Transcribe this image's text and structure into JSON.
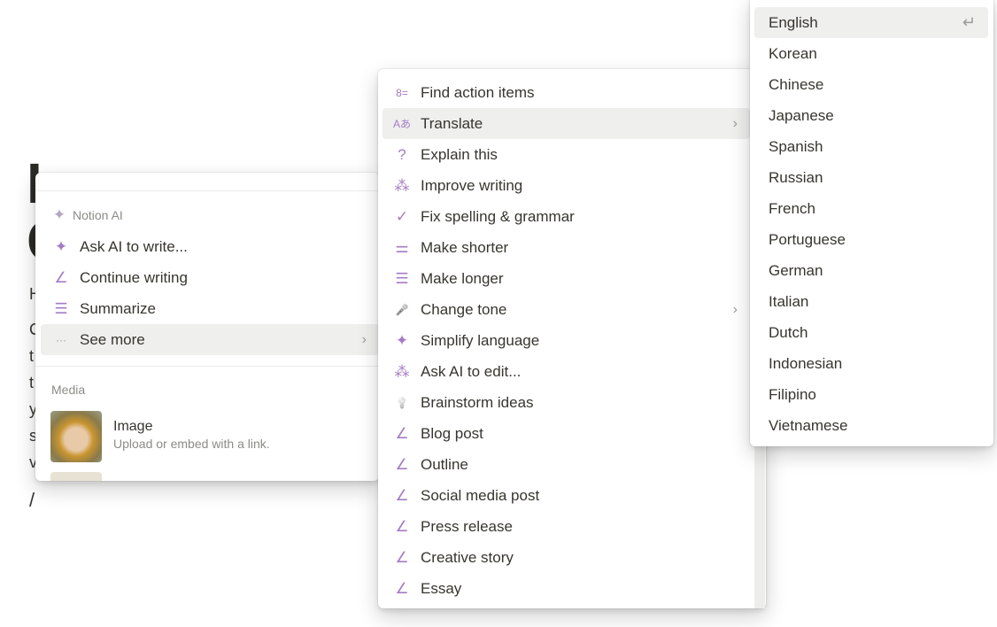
{
  "background": {
    "lines": [
      "H",
      "C",
      "t",
      "t",
      "y",
      "s",
      "v"
    ],
    "cursor": "/"
  },
  "left_menu": {
    "section_ai": "Notion AI",
    "items": [
      {
        "label": "Ask AI to write...",
        "icon": "sparkle-icon",
        "glyph": "✦"
      },
      {
        "label": "Continue writing",
        "icon": "pen-icon",
        "glyph": "∠"
      },
      {
        "label": "Summarize",
        "icon": "summary-icon",
        "glyph": "☰"
      },
      {
        "label": "See more",
        "icon": "more-icon",
        "glyph": "···"
      }
    ],
    "section_media": "Media",
    "media": [
      {
        "title": "Image",
        "desc": "Upload or embed with a link."
      }
    ]
  },
  "middle_menu": {
    "items": [
      {
        "label": "Find action items",
        "icon": "checklist-icon",
        "glyph": "8="
      },
      {
        "label": "Translate",
        "icon": "translate-icon",
        "glyph": "Aあ",
        "submenu": true
      },
      {
        "label": "Explain this",
        "icon": "question-icon",
        "glyph": "?"
      },
      {
        "label": "Improve writing",
        "icon": "burst-icon",
        "glyph": "⁂"
      },
      {
        "label": "Fix spelling & grammar",
        "icon": "check-icon",
        "glyph": "✓"
      },
      {
        "label": "Make shorter",
        "icon": "short-lines-icon",
        "glyph": "⚌"
      },
      {
        "label": "Make longer",
        "icon": "long-lines-icon",
        "glyph": "☰"
      },
      {
        "label": "Change tone",
        "icon": "microphone-icon",
        "glyph": "🎤",
        "submenu": true
      },
      {
        "label": "Simplify language",
        "icon": "sparkle-icon",
        "glyph": "✦"
      },
      {
        "label": "Ask AI to edit...",
        "icon": "burst-icon",
        "glyph": "⁂"
      },
      {
        "label": "Brainstorm ideas",
        "icon": "lightbulb-icon",
        "glyph": "💡"
      },
      {
        "label": "Blog post",
        "icon": "pen-icon",
        "glyph": "∠"
      },
      {
        "label": "Outline",
        "icon": "pen-icon",
        "glyph": "∠"
      },
      {
        "label": "Social media post",
        "icon": "pen-icon",
        "glyph": "∠"
      },
      {
        "label": "Press release",
        "icon": "pen-icon",
        "glyph": "∠"
      },
      {
        "label": "Creative story",
        "icon": "pen-icon",
        "glyph": "∠"
      },
      {
        "label": "Essay",
        "icon": "pen-icon",
        "glyph": "∠"
      }
    ]
  },
  "language_menu": {
    "selected": "English",
    "enter_glyph": "↵",
    "items": [
      "English",
      "Korean",
      "Chinese",
      "Japanese",
      "Spanish",
      "Russian",
      "French",
      "Portuguese",
      "German",
      "Italian",
      "Dutch",
      "Indonesian",
      "Filipino",
      "Vietnamese"
    ]
  },
  "colors": {
    "icon": "#a57cc4",
    "hover": "#efefee",
    "text": "#37352f"
  }
}
